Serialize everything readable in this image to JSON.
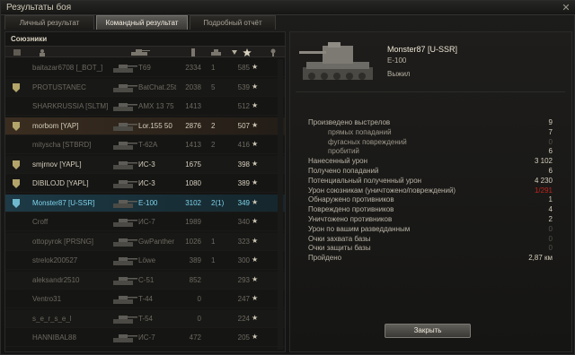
{
  "window": {
    "title": "Результаты боя",
    "close_glyph": "✕"
  },
  "tabs": [
    {
      "label": "Личный результат",
      "active": false
    },
    {
      "label": "Командный результат",
      "active": true
    },
    {
      "label": "Подробный отчёт",
      "active": false
    }
  ],
  "left": {
    "allies_label": "Союзники",
    "header_icons": [
      "badge-icon",
      "player-icon",
      "tank-icon",
      "damage-icon",
      "kills-icon",
      "sort-arrow-icon",
      "xp-star-icon",
      "medal-icon"
    ],
    "rows": [
      {
        "player": "baitazar6708 [_BOT_]",
        "tank": "T69",
        "damage": "2334",
        "frags": "1",
        "xp": "585",
        "state": "dead",
        "badge": false
      },
      {
        "player": "PROTUSTANEC",
        "tank": "BatChat.25t",
        "damage": "2038",
        "frags": "5",
        "xp": "539",
        "state": "dead",
        "badge": true
      },
      {
        "player": "SHARKRUSSIA [SLTM]",
        "tank": "AMX 13 75",
        "damage": "1413",
        "frags": "",
        "xp": "512",
        "state": "dead",
        "badge": false
      },
      {
        "player": "morbom [YAP]",
        "tank": "Lor.155 50",
        "damage": "2876",
        "frags": "2",
        "xp": "507",
        "state": "highlight",
        "badge": true
      },
      {
        "player": "mityscha [STBRD]",
        "tank": "T-62A",
        "damage": "1413",
        "frags": "2",
        "xp": "416",
        "state": "dead",
        "badge": false
      },
      {
        "player": "smjrnov [YAPL]",
        "tank": "ИС-3",
        "damage": "1675",
        "frags": "",
        "xp": "398",
        "state": "alive",
        "badge": true
      },
      {
        "player": "DIBILOJD [YAPL]",
        "tank": "ИС-3",
        "damage": "1080",
        "frags": "",
        "xp": "389",
        "state": "alive",
        "badge": true
      },
      {
        "player": "Monster87 [U-SSR]",
        "tank": "E-100",
        "damage": "3102",
        "frags": "2(1)",
        "xp": "349",
        "state": "me",
        "badge": true
      },
      {
        "player": "Croff",
        "tank": "ИС-7",
        "damage": "1989",
        "frags": "",
        "xp": "340",
        "state": "dead",
        "badge": false
      },
      {
        "player": "ottopyrok [PRSNG]",
        "tank": "GwPanther",
        "damage": "1026",
        "frags": "1",
        "xp": "323",
        "state": "dead",
        "badge": false
      },
      {
        "player": "strelok200527",
        "tank": "Löwe",
        "damage": "389",
        "frags": "1",
        "xp": "300",
        "state": "dead",
        "badge": false
      },
      {
        "player": "aleksandr2510",
        "tank": "С-51",
        "damage": "852",
        "frags": "",
        "xp": "293",
        "state": "dead",
        "badge": false
      },
      {
        "player": "Ventro31",
        "tank": "T-44",
        "damage": "0",
        "frags": "",
        "xp": "247",
        "state": "dead",
        "badge": false
      },
      {
        "player": "s_e_r_s_e_l",
        "tank": "T-54",
        "damage": "0",
        "frags": "",
        "xp": "224",
        "state": "dead",
        "badge": false
      },
      {
        "player": "HANNIBAL88",
        "tank": "ИС-7",
        "damage": "472",
        "frags": "",
        "xp": "205",
        "state": "dead",
        "badge": false
      }
    ]
  },
  "right": {
    "player_name": "Monster87 [U-SSR]",
    "tank_name": "E-100",
    "status": "Выжил",
    "stats": [
      {
        "label": "Произведено выстрелов",
        "value": "9",
        "sub": false,
        "tone": ""
      },
      {
        "label": "прямых попаданий",
        "value": "7",
        "sub": true,
        "tone": ""
      },
      {
        "label": "фугасных повреждений",
        "value": "0",
        "sub": true,
        "tone": "dim"
      },
      {
        "label": "пробитий",
        "value": "6",
        "sub": true,
        "tone": ""
      },
      {
        "label": "Нанесенный урон",
        "value": "3 102",
        "sub": false,
        "tone": ""
      },
      {
        "label": "Получено попаданий",
        "value": "6",
        "sub": false,
        "tone": ""
      },
      {
        "label": "Потенциальный полученный урон",
        "value": "4 230",
        "sub": false,
        "tone": ""
      },
      {
        "label": "Урон союзникам (уничтожено/повреждений)",
        "value": "1/291",
        "sub": false,
        "tone": "red"
      },
      {
        "label": "Обнаружено противников",
        "value": "1",
        "sub": false,
        "tone": ""
      },
      {
        "label": "Повреждено противников",
        "value": "4",
        "sub": false,
        "tone": ""
      },
      {
        "label": "Уничтожено противников",
        "value": "2",
        "sub": false,
        "tone": ""
      },
      {
        "label": "Урон по вашим разведданным",
        "value": "0",
        "sub": false,
        "tone": "dim"
      },
      {
        "label": "Очки захвата базы",
        "value": "0",
        "sub": false,
        "tone": "dim"
      },
      {
        "label": "Очки защиты базы",
        "value": "0",
        "sub": false,
        "tone": "dim"
      },
      {
        "label": "Пройдено",
        "value": "2,87 км",
        "sub": false,
        "tone": ""
      }
    ],
    "close_button": "Закрыть"
  }
}
